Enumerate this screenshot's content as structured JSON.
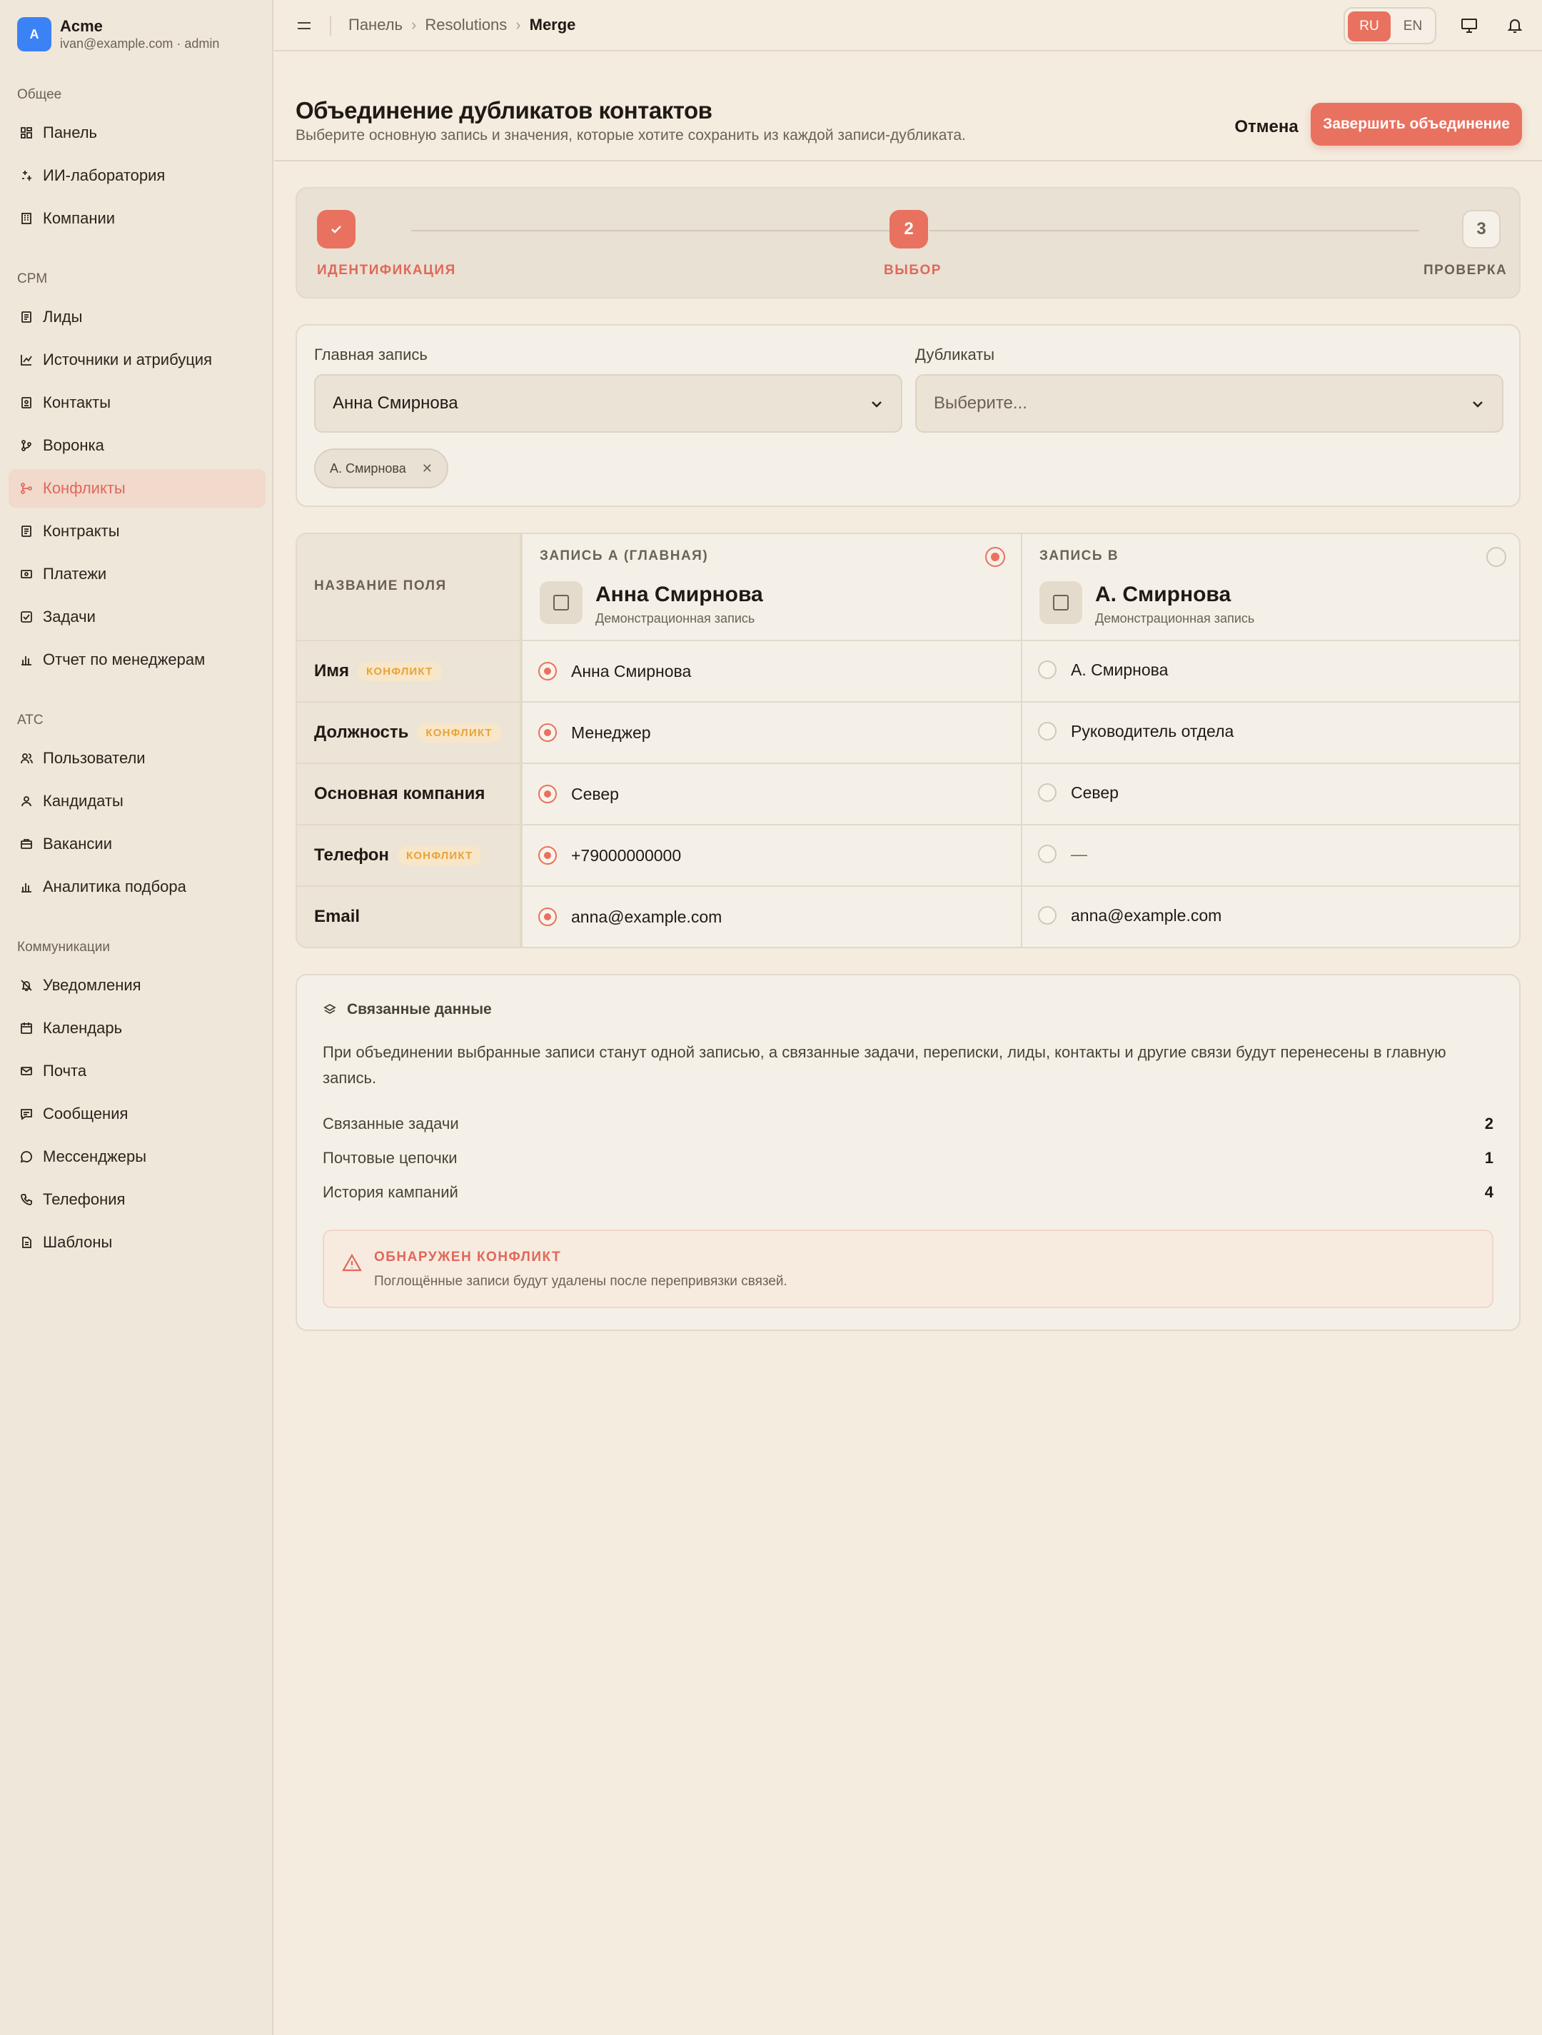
{
  "brand": {
    "initial": "A",
    "name": "Acme",
    "account": "ivan@example.com · admin"
  },
  "sidebar": {
    "sections": [
      {
        "title": "Общее",
        "items": [
          {
            "label": "Панель",
            "icon": "dashboard-icon"
          },
          {
            "label": "ИИ-лаборатория",
            "icon": "sparkle-icon"
          },
          {
            "label": "Компании",
            "icon": "building-icon"
          }
        ]
      },
      {
        "title": "CPM",
        "items": [
          {
            "label": "Лиды",
            "icon": "document-icon"
          },
          {
            "label": "Источники и атрибуция",
            "icon": "chart-line-icon"
          },
          {
            "label": "Контакты",
            "icon": "contact-card-icon"
          },
          {
            "label": "Воронка",
            "icon": "funnel-icon"
          },
          {
            "label": "Конфликты",
            "icon": "merge-icon",
            "active": true
          },
          {
            "label": "Контракты",
            "icon": "document-icon"
          },
          {
            "label": "Платежи",
            "icon": "payment-icon"
          },
          {
            "label": "Задачи",
            "icon": "checkbox-icon"
          },
          {
            "label": "Отчет по менеджерам",
            "icon": "bar-chart-icon"
          }
        ]
      },
      {
        "title": "ATC",
        "items": [
          {
            "label": "Пользователи",
            "icon": "users-icon"
          },
          {
            "label": "Кандидаты",
            "icon": "user-icon"
          },
          {
            "label": "Вакансии",
            "icon": "briefcase-icon"
          },
          {
            "label": "Аналитика подбора",
            "icon": "bar-chart-icon"
          }
        ]
      },
      {
        "title": "Коммуникации",
        "items": [
          {
            "label": "Уведомления",
            "icon": "bell-off-icon"
          },
          {
            "label": "Календарь",
            "icon": "calendar-icon"
          },
          {
            "label": "Почта",
            "icon": "mail-icon"
          },
          {
            "label": "Сообщения",
            "icon": "message-square-icon"
          },
          {
            "label": "Мессенджеры",
            "icon": "chat-bubble-icon"
          },
          {
            "label": "Телефония",
            "icon": "phone-icon"
          },
          {
            "label": "Шаблоны",
            "icon": "template-icon"
          }
        ]
      }
    ]
  },
  "topbar": {
    "breadcrumbs": [
      "Панель",
      "Resolutions",
      "Merge"
    ],
    "lang_ru": "RU",
    "lang_en": "EN"
  },
  "header": {
    "title": "Объединение дубликатов контактов",
    "subtitle": "Выберите основную запись и значения, которые хотите сохранить из каждой записи-дубликата.",
    "cancel": "Отмена",
    "finish": "Завершить объединение"
  },
  "stepper": {
    "steps": [
      {
        "label": "ИДЕНТИФИКАЦИЯ",
        "state": "done",
        "number": ""
      },
      {
        "label": "ВЫБОР",
        "state": "current",
        "number": "2"
      },
      {
        "label": "ПРОВЕРКА",
        "state": "todo",
        "number": "3"
      }
    ]
  },
  "selection": {
    "primary_label": "Главная запись",
    "primary_value": "Анна Смирнова",
    "duplicates_label": "Дубликаты",
    "duplicates_placeholder": "Выберите...",
    "chips": [
      "А. Смирнова"
    ]
  },
  "table": {
    "field_header": "НАЗВАНИЕ ПОЛЯ",
    "badge": "КОНФЛИКТ",
    "record_a": {
      "label": "ЗАПИСЬ А (ГЛАВНАЯ)",
      "name": "Анна Смирнова",
      "desc": "Демонстрационная запись",
      "selected": true
    },
    "record_b": {
      "label": "ЗАПИСЬ В",
      "name": "А. Смирнова",
      "desc": "Демонстрационная запись",
      "selected": false
    },
    "rows": [
      {
        "field": "Имя",
        "conflict": true,
        "a": "Анна Смирнова",
        "b": "А. Смирнова"
      },
      {
        "field": "Должность",
        "conflict": true,
        "a": "Менеджер",
        "b": "Руководитель отдела"
      },
      {
        "field": "Основная компания",
        "conflict": false,
        "a": "Север",
        "b": "Север"
      },
      {
        "field": "Телефон",
        "conflict": true,
        "a": "+79000000000",
        "b": "—"
      },
      {
        "field": "Email",
        "conflict": false,
        "a": "anna@example.com",
        "b": "anna@example.com"
      }
    ]
  },
  "related": {
    "title": "Связанные данные",
    "text": "При объединении выбранные записи станут одной записью, а связанные задачи, переписки, лиды, контакты и другие связи будут перенесены в главную запись.",
    "stats": [
      {
        "label": "Связанные задачи",
        "value": "2"
      },
      {
        "label": "Почтовые цепочки",
        "value": "1"
      },
      {
        "label": "История кампаний",
        "value": "4"
      }
    ],
    "alert_title": "ОБНАРУЖЕН КОНФЛИКТ",
    "alert_text": "Поглощённые записи будут удалены после перепривязки связей."
  },
  "colors": {
    "accent": "#e9715f",
    "badge_text": "#e8a33a",
    "background": "#f3ecdf"
  }
}
